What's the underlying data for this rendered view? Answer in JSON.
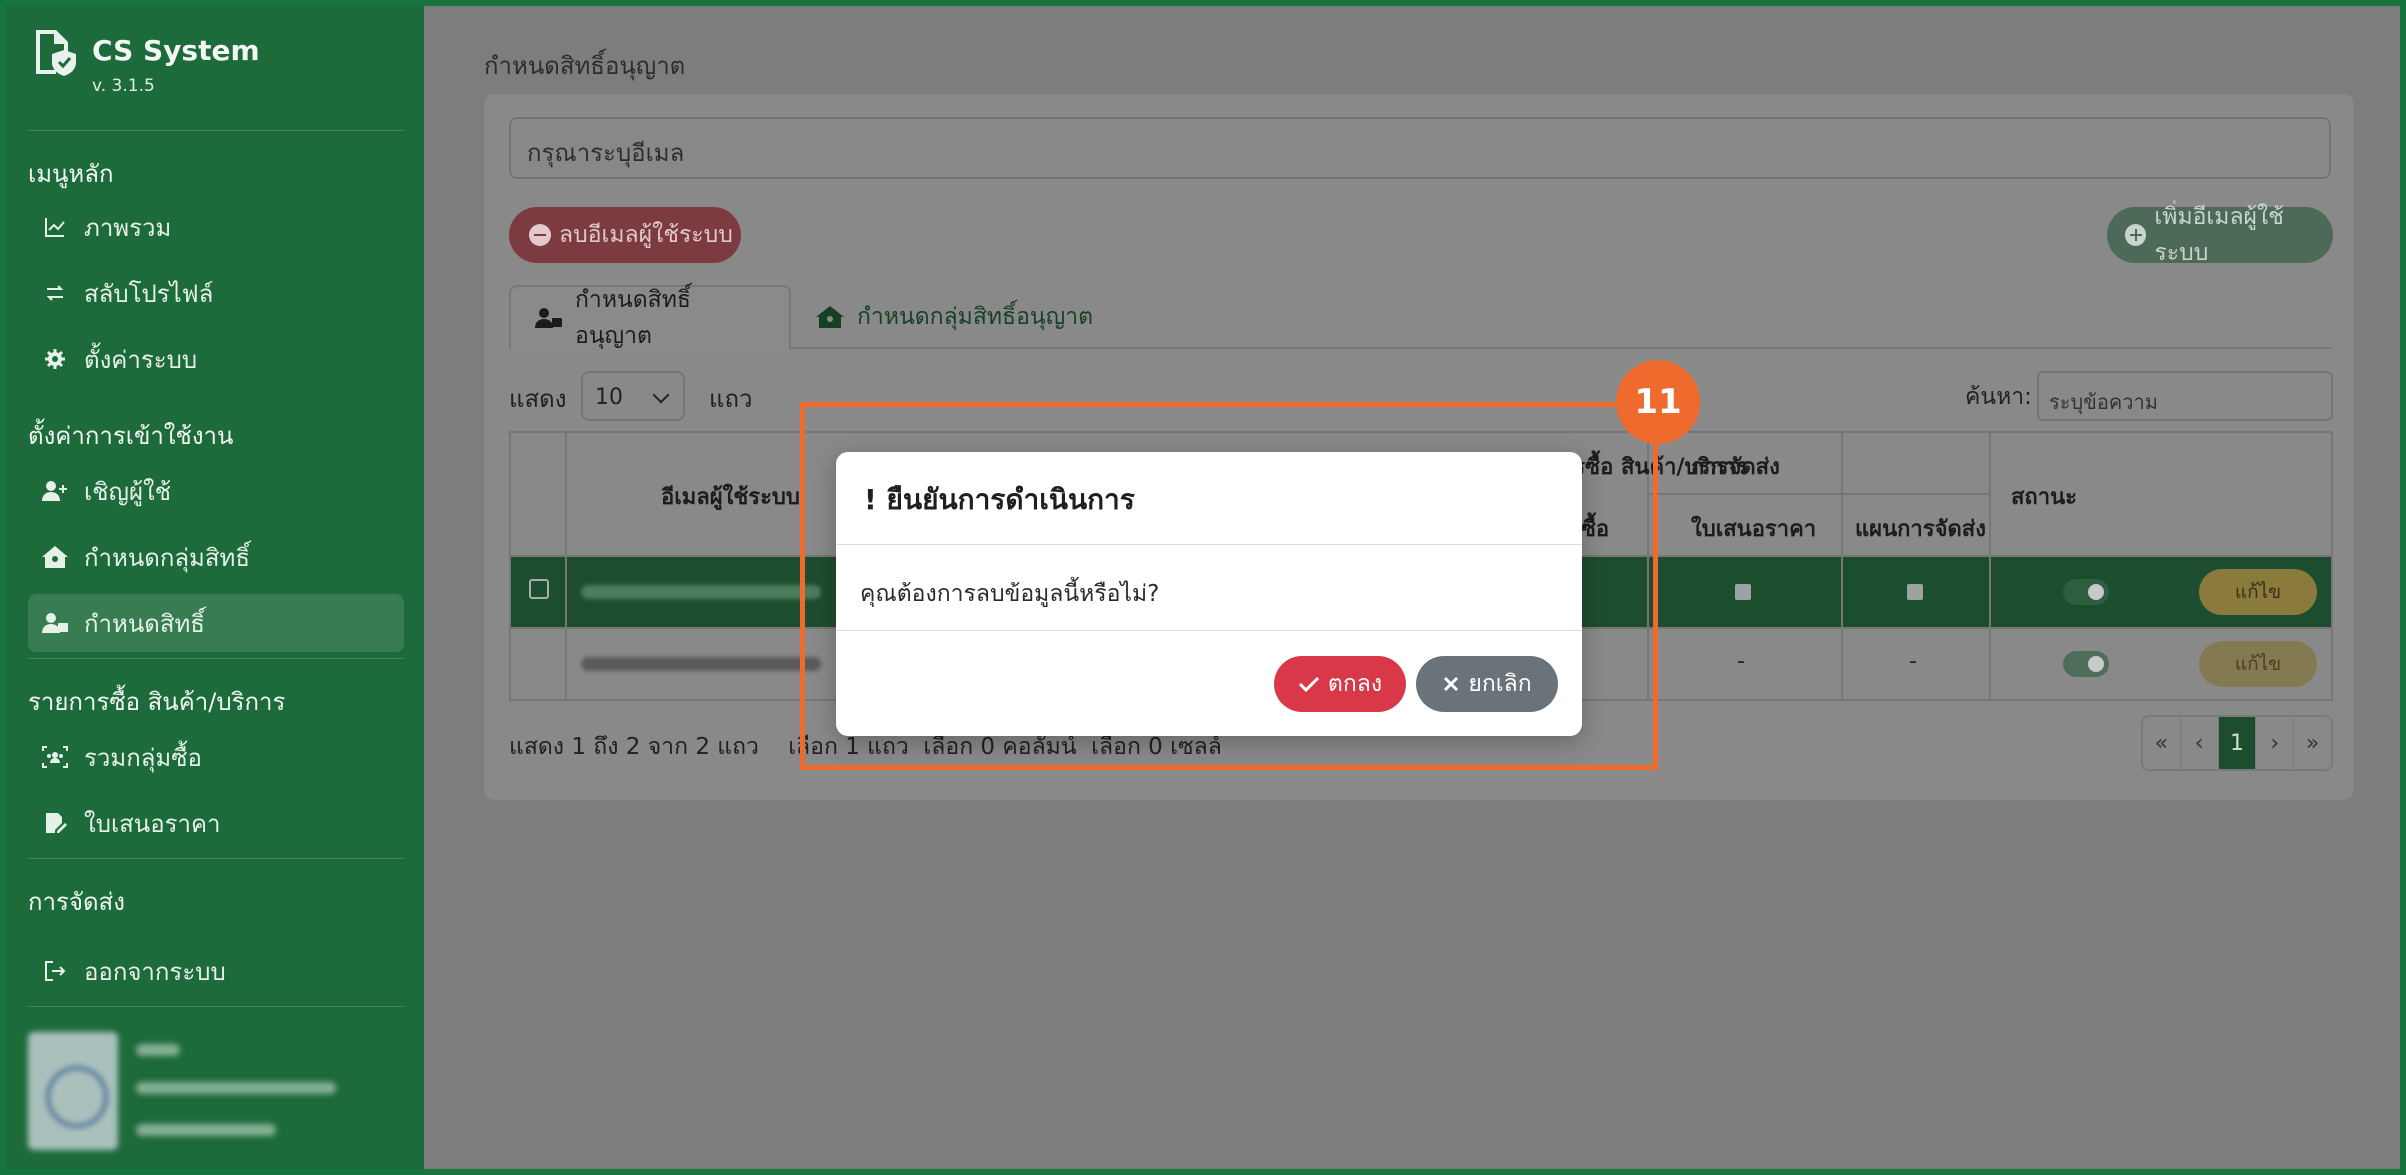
{
  "app": {
    "title": "CS System",
    "version": "v. 3.1.5"
  },
  "sidebar": {
    "sections": [
      {
        "heading": "เมนูหลัก",
        "items": [
          {
            "label": "ภาพรวม",
            "icon": "chart-line-icon"
          },
          {
            "label": "สลับโปรไฟล์",
            "icon": "switch-icon"
          },
          {
            "label": "ตั้งค่าระบบ",
            "icon": "gear-icon"
          }
        ]
      },
      {
        "heading": "ตั้งค่าการเข้าใช้งาน",
        "items": [
          {
            "label": "เชิญผู้ใช้",
            "icon": "user-plus-icon"
          },
          {
            "label": "กำหนดกลุ่มสิทธิ์",
            "icon": "house-users-icon"
          },
          {
            "label": "กำหนดสิทธิ์",
            "icon": "user-lock-icon",
            "active": true
          }
        ]
      },
      {
        "heading": "รายการซื้อ สินค้า/บริการ",
        "items": [
          {
            "label": "รวมกลุ่มซื้อ",
            "icon": "group-icon"
          },
          {
            "label": "ใบเสนอราคา",
            "icon": "document-edit-icon"
          }
        ]
      },
      {
        "heading": "การจัดส่ง",
        "items": [
          {
            "label": "ออกจากระบบ",
            "icon": "logout-icon"
          }
        ]
      }
    ]
  },
  "page": {
    "title": "กำหนดสิทธิ์อนุญาต",
    "email_placeholder": "กรุณาระบุอีเมล",
    "delete_button": "ลบอีเมลผู้ใช้ระบบ",
    "add_button": "เพิ่มอีเมลผู้ใช้ระบบ",
    "tabs": [
      {
        "label": "กำหนดสิทธิ์อนุญาต",
        "active": true
      },
      {
        "label": "กำหนดกลุ่มสิทธิ์อนุญาต",
        "active": false
      }
    ],
    "show_label": "แสดง",
    "page_length": "10",
    "rows_unit": "แถว",
    "search_label": "ค้นหา:",
    "search_placeholder": "ระบุข้อความ",
    "table": {
      "header_email": "อีเมลผู้ใช้ระบบ",
      "header_group_purchase_partial": "ารซื้อ สินค้า/บริการ",
      "header_group_shipping": "การจัดส่ง",
      "header_status": "สถานะ",
      "sub_purchase_partial": "ซื้อ",
      "sub_quotation": "ใบเสนอราคา",
      "sub_shipping_plan": "แผนการจัดส่ง",
      "edit_label": "แก้ไข",
      "dash": "-"
    },
    "info_text_left": "แสดง 1 ถึง 2 จาก 2 แถว",
    "info_text_right": "เลือก 1 แถว  เลือก 0 คอลัมน์  เลือก 0 เซลล์",
    "info_text_mid": "เลือ",
    "pager": [
      "«",
      "‹",
      "1",
      "›",
      "»"
    ]
  },
  "modal": {
    "title": "ยืนยันการดำเนินการ",
    "title_mark": "!",
    "body": "คุณต้องการลบข้อมูลนี้หรือไม่?",
    "ok": "ตกลง",
    "cancel": "ยกเลิก"
  },
  "annotation": {
    "step": "11"
  },
  "colors": {
    "accent": "#1d6b3a",
    "danger": "#d93848",
    "highlight": "#ee6b2d"
  }
}
